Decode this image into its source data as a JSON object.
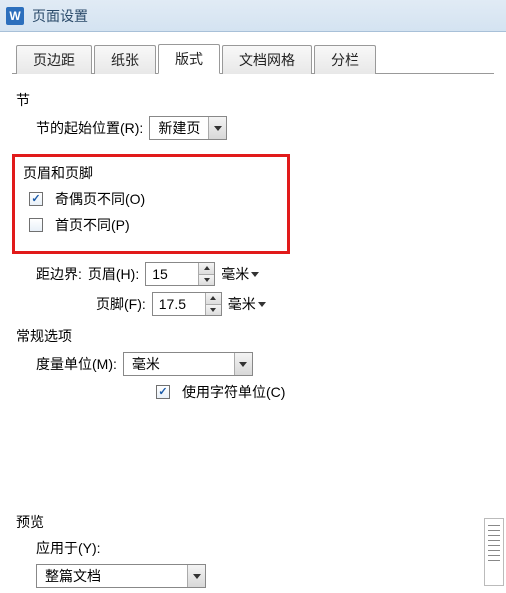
{
  "window": {
    "title": "页面设置"
  },
  "tabs": {
    "margins": "页边距",
    "paper": "纸张",
    "layout": "版式",
    "grid": "文档网格",
    "columns": "分栏"
  },
  "section": {
    "heading": "节",
    "start_label": "节的起始位置(R):",
    "start_value": "新建页"
  },
  "header_footer": {
    "heading": "页眉和页脚",
    "odd_even_label": "奇偶页不同(O)",
    "odd_even_checked": true,
    "first_page_label": "首页不同(P)",
    "first_page_checked": false,
    "distance_label": "距边界:",
    "header_label": "页眉(H):",
    "header_value": "15",
    "footer_label": "页脚(F):",
    "footer_value": "17.5",
    "unit": "毫米",
    "unit_suffix": "▾"
  },
  "general": {
    "heading": "常规选项",
    "unit_label": "度量单位(M):",
    "unit_value": "毫米",
    "char_unit_label": "使用字符单位(C)",
    "char_unit_checked": true
  },
  "preview": {
    "heading": "预览",
    "apply_label": "应用于(Y):",
    "apply_value": "整篇文档"
  }
}
